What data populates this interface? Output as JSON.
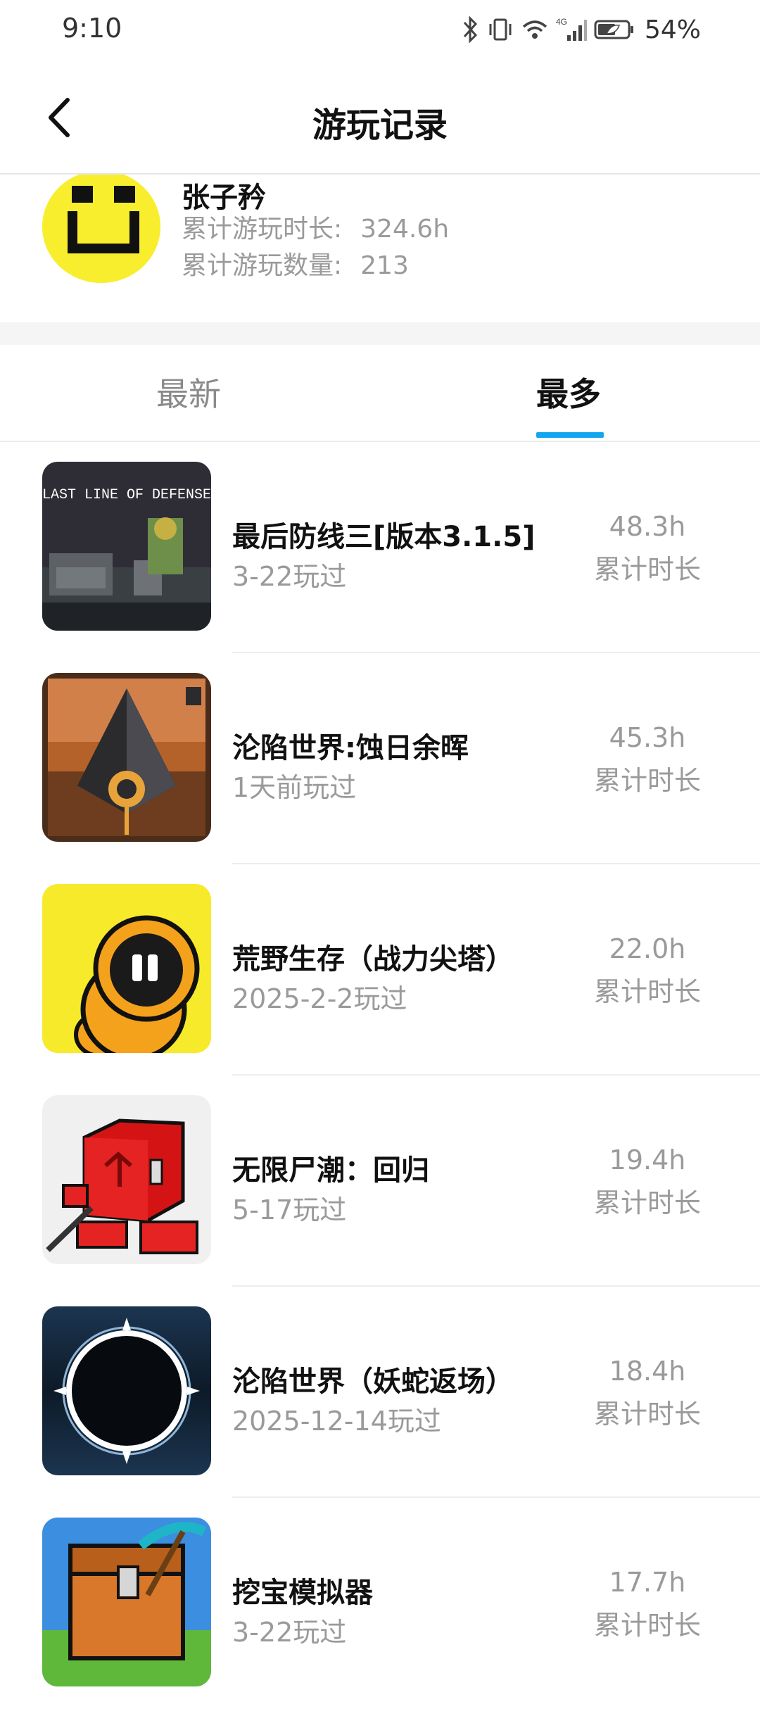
{
  "status_bar": {
    "time": "9:10",
    "battery": "54%"
  },
  "header": {
    "title": "游玩记录"
  },
  "profile": {
    "name": "张子矜",
    "total_time_label": "累计游玩时长:",
    "total_time_value": "324.6h",
    "total_count_label": "累计游玩数量:",
    "total_count_value": "213"
  },
  "tabs": [
    {
      "label": "最新",
      "selected": false
    },
    {
      "label": "最多",
      "selected": true
    }
  ],
  "accent_color": "#13a6ee",
  "games": [
    {
      "title": "最后防线三[版本3.1.5]",
      "played": "3-22玩过",
      "hours": "48.3h",
      "hours_label": "累计时长",
      "icon": "last-line-of-defense-icon",
      "icon_text": "LAST LINE OF DEFENSE"
    },
    {
      "title": "沦陷世界:蚀日余晖",
      "played": "1天前玩过",
      "hours": "45.3h",
      "hours_label": "累计时长",
      "icon": "fallen-world-eclipse-icon"
    },
    {
      "title": "荒野生存（战力尖塔）",
      "played": "2025-2-2玩过",
      "hours": "22.0h",
      "hours_label": "累计时长",
      "icon": "hooded-character-icon"
    },
    {
      "title": "无限尸潮：回归",
      "played": "5-17玩过",
      "hours": "19.4h",
      "hours_label": "累计时长",
      "icon": "red-cube-character-icon"
    },
    {
      "title": "沦陷世界（妖蛇返场）",
      "played": "2025-12-14玩过",
      "hours": "18.4h",
      "hours_label": "累计时长",
      "icon": "dark-ring-icon"
    },
    {
      "title": "挖宝模拟器",
      "played": "3-22玩过",
      "hours": "17.7h",
      "hours_label": "累计时长",
      "icon": "treasure-chest-pickaxe-icon"
    }
  ]
}
